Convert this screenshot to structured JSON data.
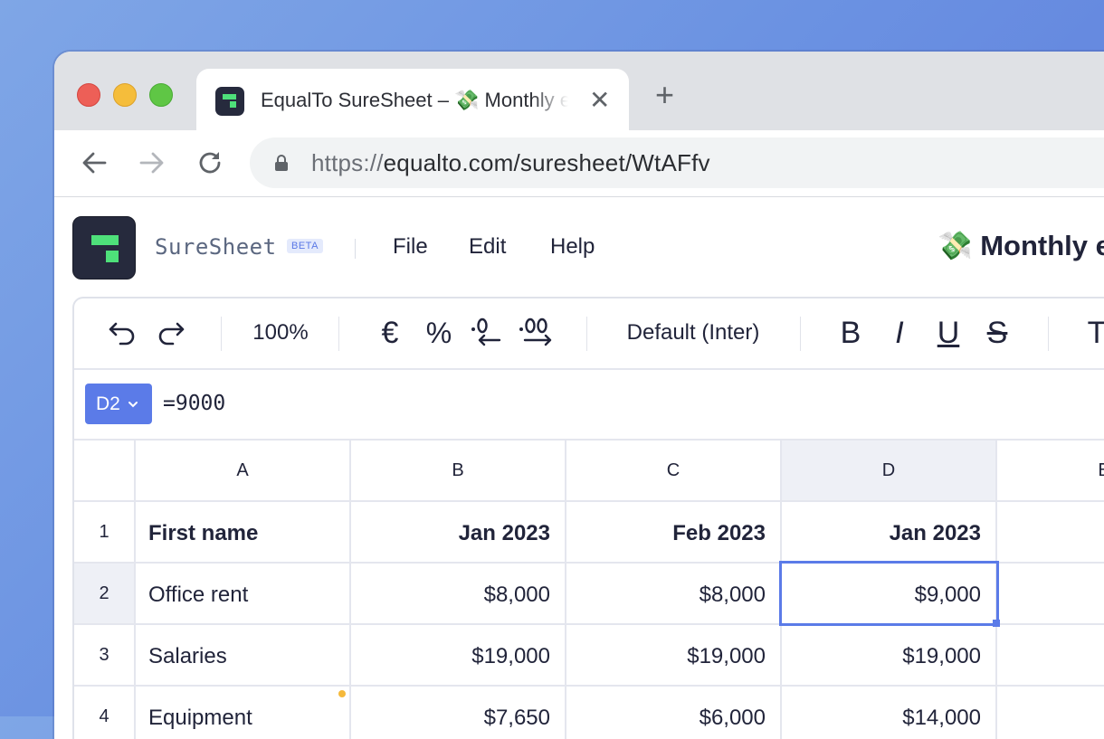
{
  "browser": {
    "tab_title": "EqualTo SureSheet – 💸 Monthly expenses",
    "tab_close": "✕",
    "new_tab": "+",
    "url_scheme": "https://",
    "url_rest": "equalto.com/suresheet/WtAFfv"
  },
  "app": {
    "brand": "SureSheet",
    "badge": "BETA",
    "menu": [
      "File",
      "Edit",
      "Help"
    ],
    "doc_title": "💸 Monthly e"
  },
  "ribbon": {
    "zoom": "100%",
    "currency": "€",
    "percent": "%",
    "font": "Default (Inter)",
    "bold": "B",
    "italic": "I",
    "underline": "U",
    "strike": "S",
    "text": "T"
  },
  "formula_bar": {
    "cell_ref": "D2",
    "formula": "=9000"
  },
  "grid": {
    "columns": [
      "A",
      "B",
      "C",
      "D",
      "E"
    ],
    "rows": [
      {
        "num": "1",
        "cells": [
          "First name",
          "Jan 2023",
          "Feb 2023",
          "Jan 2023"
        ]
      },
      {
        "num": "2",
        "cells": [
          "Office rent",
          "$8,000",
          "$8,000",
          "$9,000"
        ]
      },
      {
        "num": "3",
        "cells": [
          "Salaries",
          "$19,000",
          "$19,000",
          "$19,000"
        ]
      },
      {
        "num": "4",
        "cells": [
          "Equipment",
          "$7,650",
          "$6,000",
          "$14,000"
        ]
      }
    ],
    "selected_cell": "D2"
  },
  "colors": {
    "accent": "#5b7be8",
    "brand_green": "#4ee07a",
    "logo_bg": "#262a3d"
  }
}
